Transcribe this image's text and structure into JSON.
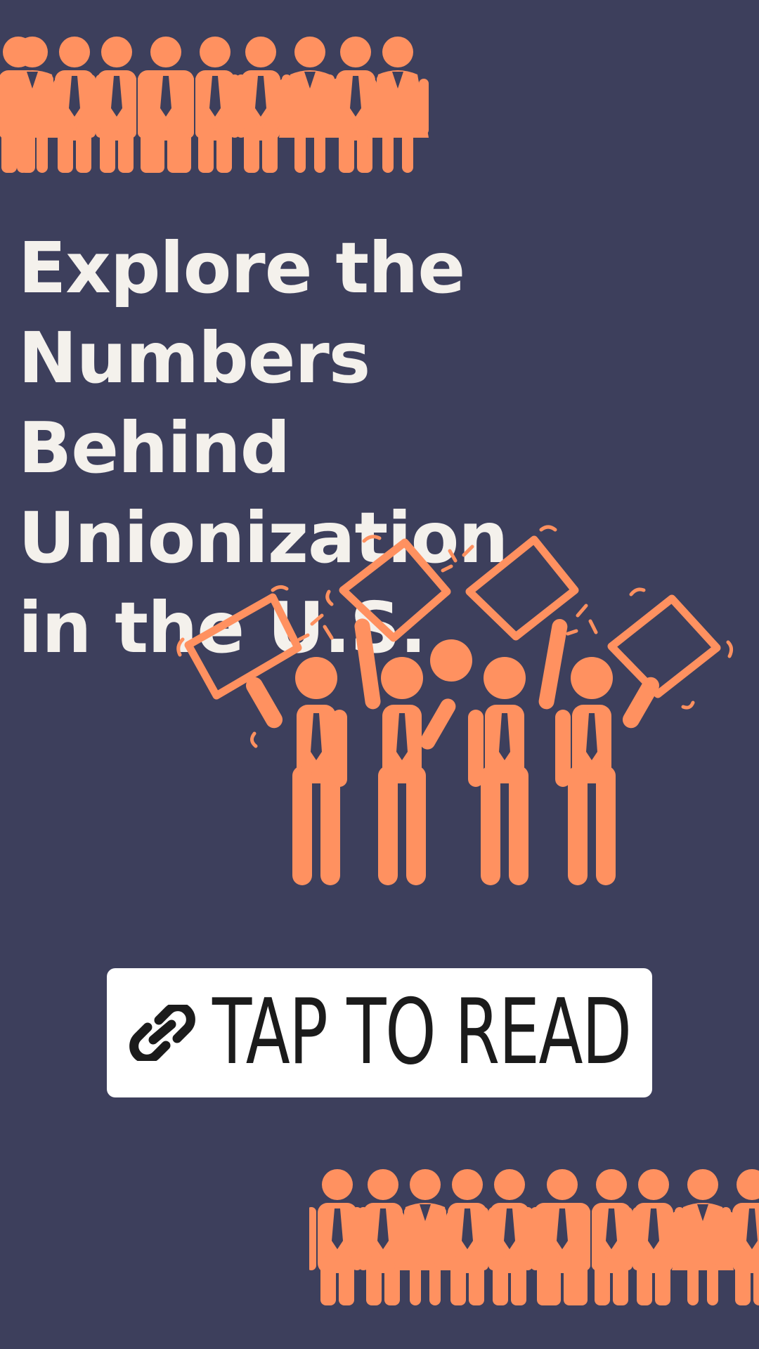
{
  "headline": "Explore the Numbers Behind Unionization in the U.S.",
  "cta": {
    "label": "TAP TO READ"
  },
  "icons": {
    "top_crowd": "people-crowd-icon",
    "protest": "protest-group-icon",
    "link": "link-icon",
    "bottom_crowd": "people-crowd-icon"
  },
  "colors": {
    "background": "#3d3f5c",
    "accent": "#ff9160",
    "headline": "#f4f1ec",
    "button": "#ffffff",
    "button_text": "#1b1b1b"
  }
}
